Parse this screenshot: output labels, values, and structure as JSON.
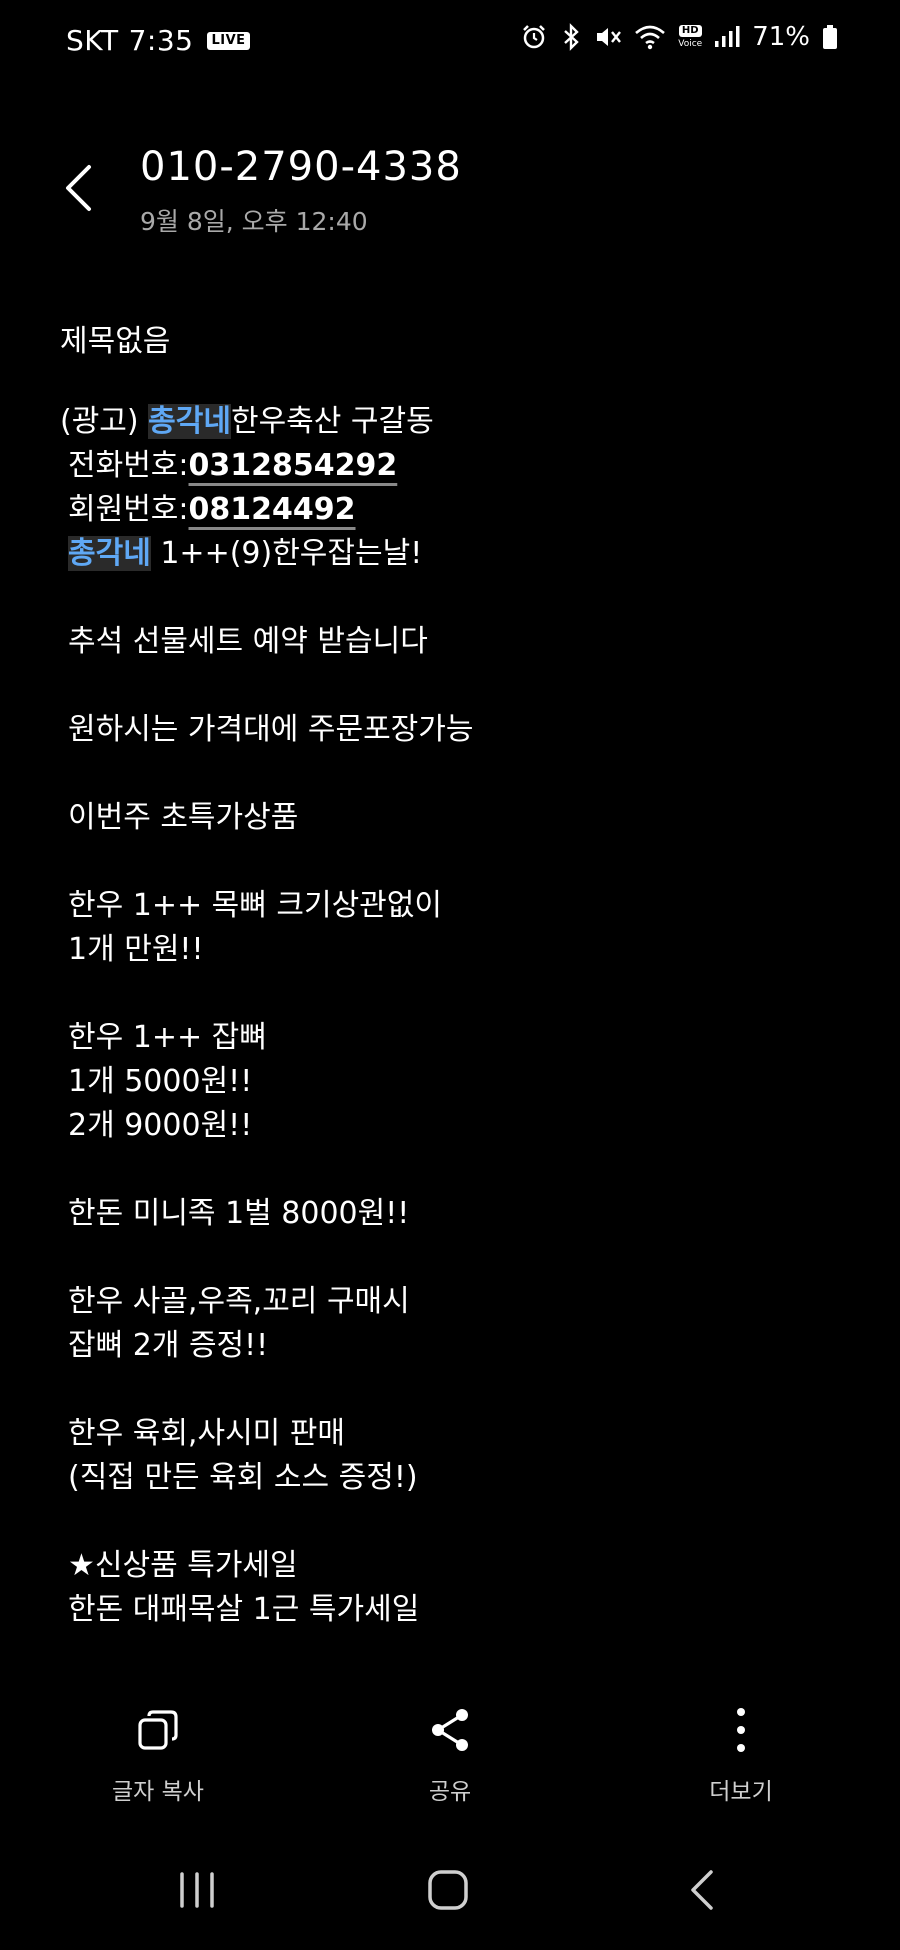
{
  "status_bar": {
    "carrier": "SKT",
    "time": "7:35",
    "live_badge": "LIVE",
    "hd_label": "HD",
    "voice_label": "Voice",
    "battery": "71%"
  },
  "header": {
    "sender": "010-2790-4338",
    "date": "9월 8일, 오후 12:40"
  },
  "message": {
    "subject": "제목없음",
    "ad_prefix": "(광고) ",
    "store_highlight": "총각네",
    "store_rest": "한우축산 구갈동",
    "phone_label": "전화번호:",
    "phone_value": "0312854292",
    "member_label": "회원번호:",
    "member_value": "08124492",
    "promo_highlight": "총각네",
    "promo_rest": " 1++(9)한우잡는날!",
    "lines": [
      "추석 선물세트 예약 받습니다",
      "원하시는 가격대에 주문포장가능",
      "이번주 초특가상품",
      "한우 1++ 목뼈 크기상관없이",
      "1개 만원!!",
      "한우 1++ 잡뼈",
      "1개 5000원!!",
      "2개 9000원!!",
      "한돈 미니족 1벌 8000원!!",
      "한우 사골,우족,꼬리 구매시",
      "잡뼈 2개 증정!!",
      "한우 육회,사시미 판매",
      "(직접 만든 육회 소스 증정!)",
      "★신상품 특가세일",
      "한돈 대패목살 1근 특가세일"
    ]
  },
  "actions": {
    "copy_label": "글자 복사",
    "share_label": "공유",
    "more_label": "더보기"
  },
  "colors": {
    "background": "#000000",
    "highlight_text": "#5fa8f5",
    "highlight_bg": "#2a2a2a",
    "secondary_text": "#a9a9a9"
  }
}
